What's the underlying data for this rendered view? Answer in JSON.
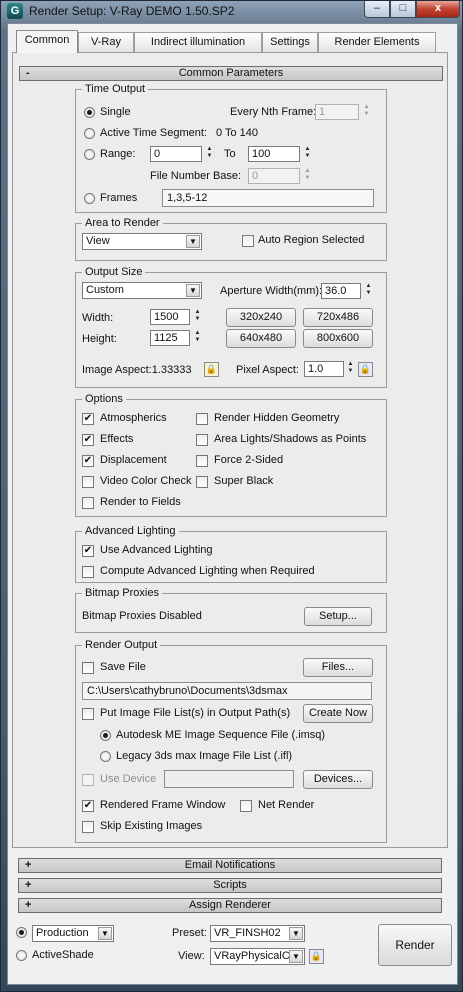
{
  "window": {
    "title": "Render Setup: V-Ray DEMO 1.50.SP2",
    "app_icon": "G",
    "min_glyph": "–",
    "max_glyph": "□",
    "close_glyph": "x"
  },
  "tabs": [
    "Common",
    "V-Ray",
    "Indirect illumination",
    "Settings",
    "Render Elements"
  ],
  "rollouts": {
    "common_parameters": {
      "label": "Common Parameters",
      "sign": "-"
    },
    "email": {
      "label": "Email Notifications",
      "sign": "+"
    },
    "scripts": {
      "label": "Scripts",
      "sign": "+"
    },
    "assign_renderer": {
      "label": "Assign Renderer",
      "sign": "+"
    }
  },
  "time_output": {
    "title": "Time Output",
    "single": "Single",
    "every_nth_label": "Every Nth Frame:",
    "every_nth_value": "1",
    "active_segment": "Active Time Segment:",
    "active_segment_range": "0 To 140",
    "range": "Range:",
    "range_from": "0",
    "range_to_label": "To",
    "range_to": "100",
    "file_number_base_label": "File Number Base:",
    "file_number_base": "0",
    "frames": "Frames",
    "frames_value": "1,3,5-12"
  },
  "area_to_render": {
    "title": "Area to Render",
    "value": "View",
    "auto_region": "Auto Region Selected"
  },
  "output_size": {
    "title": "Output Size",
    "preset": "Custom",
    "aperture_label": "Aperture Width(mm):",
    "aperture_value": "36.0",
    "width_label": "Width:",
    "width": "1500",
    "height_label": "Height:",
    "height": "1125",
    "presets": [
      "320x240",
      "720x486",
      "640x480",
      "800x600"
    ],
    "image_aspect": "Image Aspect:1.33333",
    "pixel_aspect_label": "Pixel Aspect:",
    "pixel_aspect": "1.0"
  },
  "options": {
    "title": "Options",
    "left": [
      {
        "label": "Atmospherics",
        "checked": true
      },
      {
        "label": "Effects",
        "checked": true
      },
      {
        "label": "Displacement",
        "checked": true
      },
      {
        "label": "Video Color Check",
        "checked": false
      },
      {
        "label": "Render to Fields",
        "checked": false
      }
    ],
    "right": [
      {
        "label": "Render Hidden Geometry",
        "checked": false
      },
      {
        "label": "Area Lights/Shadows as Points",
        "checked": false
      },
      {
        "label": "Force 2-Sided",
        "checked": false
      },
      {
        "label": "Super Black",
        "checked": false
      }
    ]
  },
  "advanced_lighting": {
    "title": "Advanced Lighting",
    "use": "Use Advanced Lighting",
    "compute": "Compute Advanced Lighting when Required"
  },
  "bitmap_proxies": {
    "title": "Bitmap Proxies",
    "status": "Bitmap Proxies Disabled",
    "setup": "Setup..."
  },
  "render_output": {
    "title": "Render Output",
    "save_file": "Save File",
    "files_btn": "Files...",
    "path": "C:\\Users\\cathybruno\\Documents\\3dsmax",
    "put_image": "Put Image File List(s) in Output Path(s)",
    "create_now": "Create Now",
    "imsq": "Autodesk ME Image Sequence File (.imsq)",
    "ifl": "Legacy 3ds max Image File List (.ifl)",
    "use_device": "Use Device",
    "devices_btn": "Devices...",
    "rendered_frame_window": "Rendered Frame Window",
    "net_render": "Net Render",
    "skip_existing": "Skip Existing Images"
  },
  "bottom": {
    "production": "Production",
    "activeshade": "ActiveShade",
    "preset_label": "Preset:",
    "preset_value": "VR_FINSH02",
    "view_label": "View:",
    "view_value": "VRayPhysicalC",
    "render": "Render"
  }
}
